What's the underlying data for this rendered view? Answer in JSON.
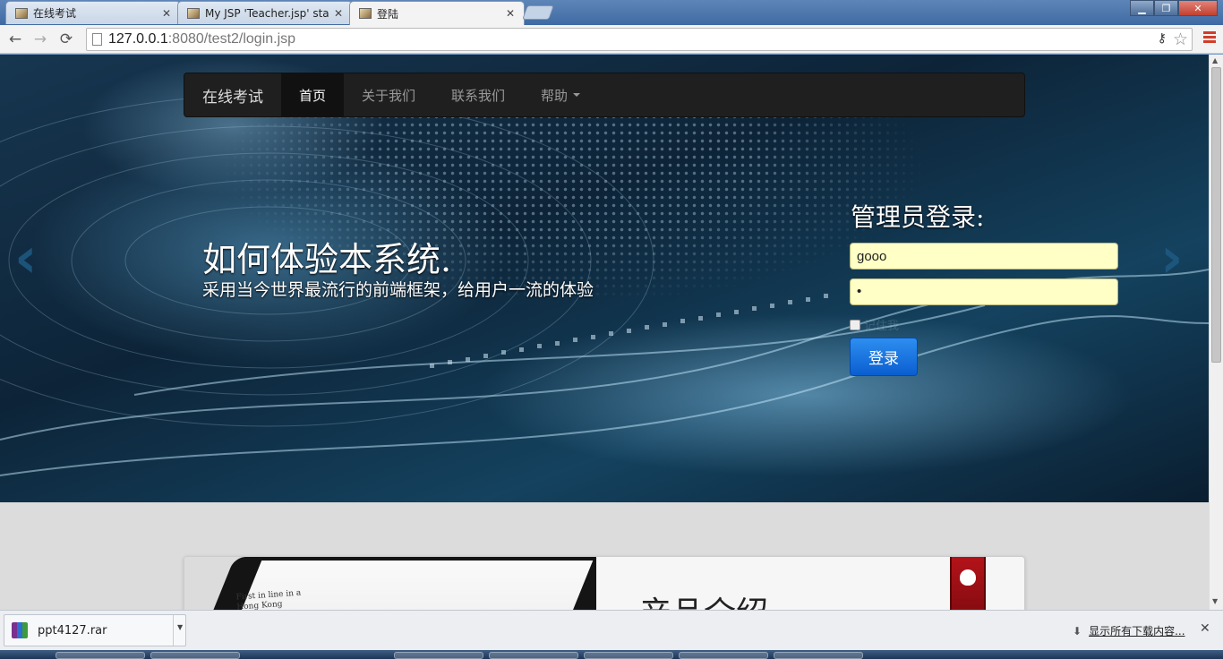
{
  "browser": {
    "tabs": [
      {
        "title": "在线考试",
        "active": false
      },
      {
        "title": "My JSP 'Teacher.jsp' sta",
        "active": false
      },
      {
        "title": "登陆",
        "active": true
      }
    ],
    "url_host": "127.0.0.1",
    "url_rest": ":8080/test2/login.jsp",
    "icons": {
      "back": "←",
      "forward": "→",
      "reload": "⟳",
      "star": "☆",
      "key": "⚷",
      "tab_close": "✕",
      "minimize": "▁",
      "maximize": "❐",
      "close": "✕"
    }
  },
  "navbar": {
    "brand": "在线考试",
    "items": [
      {
        "label": "首页",
        "active": true
      },
      {
        "label": "关于我们",
        "active": false
      },
      {
        "label": "联系我们",
        "active": false
      },
      {
        "label": "帮助",
        "active": false,
        "dropdown": true
      }
    ]
  },
  "hero": {
    "headline": "如何体验本系统.",
    "subline": "采用当今世界最流行的前端框架，给用户一流的体验",
    "prev_arrow": "‹",
    "next_arrow": "›"
  },
  "login": {
    "title": "管理员登录:",
    "username_value": "gooo",
    "password_value": "•",
    "remember_label": "记住我",
    "submit_label": "登录"
  },
  "product": {
    "title": "产品介绍",
    "tablet_text_1": "First in line in a",
    "tablet_text_2": "Hong Kong"
  },
  "downloads": {
    "file_name": "ppt4127.rar",
    "show_all": "显示所有下载内容...",
    "close": "✕",
    "dropdown": "▼",
    "arrow": "⬇"
  }
}
